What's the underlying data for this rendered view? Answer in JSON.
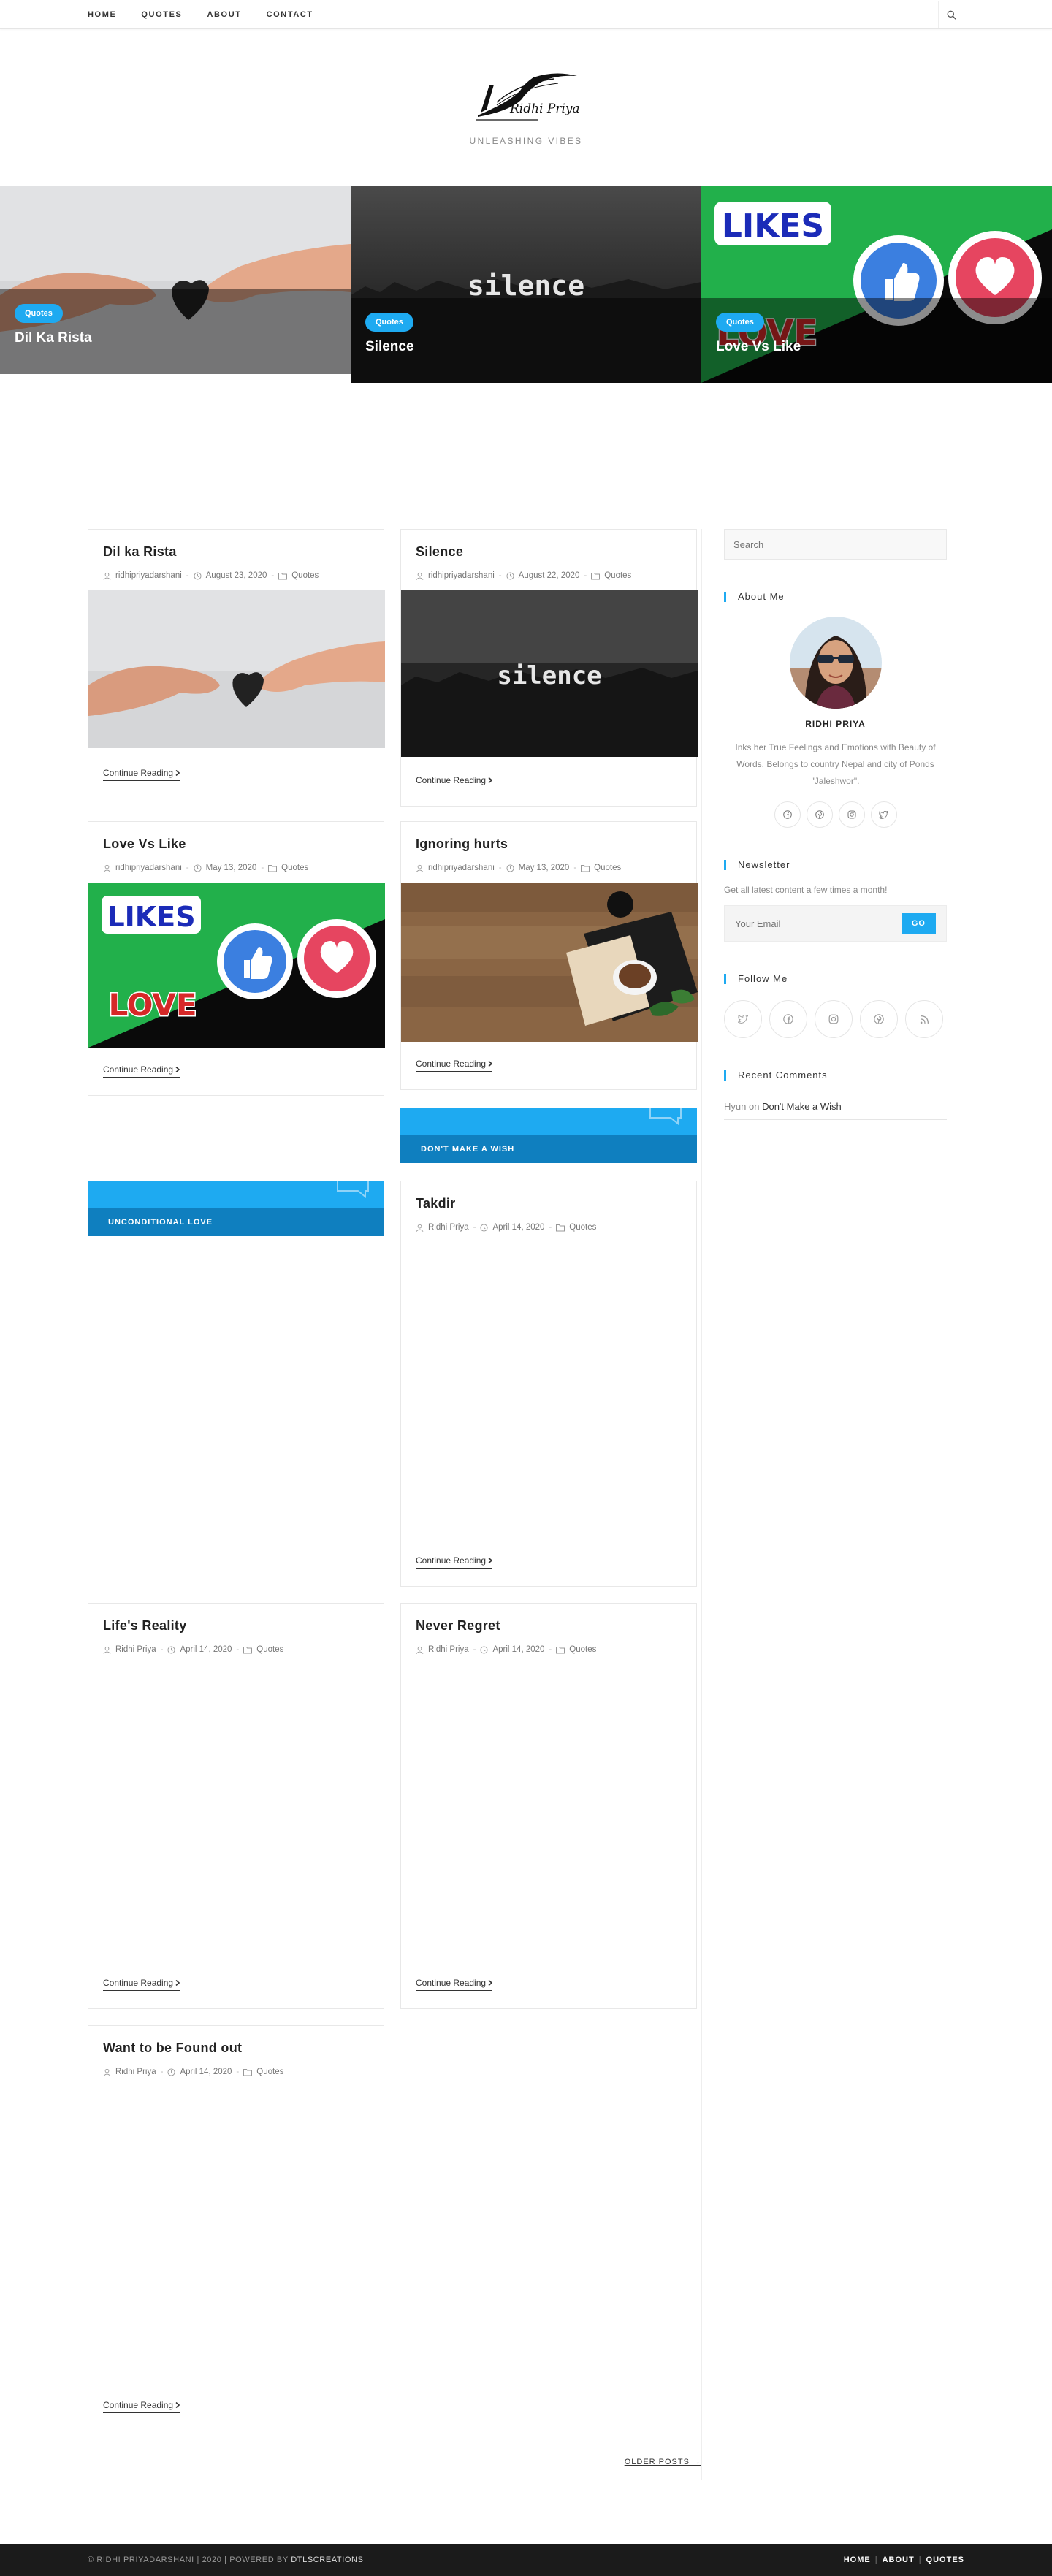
{
  "nav": {
    "items": [
      {
        "label": "HOME"
      },
      {
        "label": "QUOTES"
      },
      {
        "label": "ABOUT"
      },
      {
        "label": "CONTACT"
      }
    ]
  },
  "header": {
    "logo_text": "Ridhi Priya",
    "tagline": "UNLEASHING VIBES"
  },
  "slider": [
    {
      "badge": "Quotes",
      "title": "Dil Ka Rista"
    },
    {
      "badge": "Quotes",
      "title": "Silence",
      "image_text": "silence"
    },
    {
      "badge": "Quotes",
      "title": "Love Vs Like",
      "image_text_top": "LIKES",
      "image_text_bottom": "LOVE"
    }
  ],
  "posts": [
    {
      "title": "Dil ka Rista",
      "author": "ridhipriyadarshani",
      "date": "August 23, 2020",
      "category": "Quotes",
      "more": "Continue Reading"
    },
    {
      "title": "Silence",
      "author": "ridhipriyadarshani",
      "date": "August 22, 2020",
      "category": "Quotes",
      "more": "Continue Reading",
      "image_text": "silence"
    },
    {
      "title": "Love Vs Like",
      "author": "ridhipriyadarshani",
      "date": "May 13, 2020",
      "category": "Quotes",
      "more": "Continue Reading",
      "image_text_top": "LIKES",
      "image_text_bottom": "LOVE"
    },
    {
      "title": "Ignoring hurts",
      "author": "ridhipriyadarshani",
      "date": "May 13, 2020",
      "category": "Quotes",
      "more": "Continue Reading"
    },
    {
      "title": "Takdir",
      "author": "Ridhi Priya",
      "date": "April 14, 2020",
      "category": "Quotes",
      "more": "Continue Reading"
    },
    {
      "title": "Life's Reality",
      "author": "Ridhi Priya",
      "date": "April 14, 2020",
      "category": "Quotes",
      "more": "Continue Reading"
    },
    {
      "title": "Never Regret",
      "author": "Ridhi Priya",
      "date": "April 14, 2020",
      "category": "Quotes",
      "more": "Continue Reading"
    },
    {
      "title": "Want to be Found out",
      "author": "Ridhi Priya",
      "date": "April 14, 2020",
      "category": "Quotes",
      "more": "Continue Reading"
    }
  ],
  "banners": {
    "wish": "DON'T MAKE A WISH",
    "love": "UNCONDITIONAL LOVE"
  },
  "pagination": {
    "older": "OLDER POSTS →"
  },
  "sidebar": {
    "search_placeholder": "Search",
    "about": {
      "title": "About Me",
      "name": "RIDHI PRIYA",
      "bio": "Inks her True Feelings and Emotions with Beauty of Words. Belongs to country Nepal and city of Ponds \"Jaleshwor\"."
    },
    "newsletter": {
      "title": "Newsletter",
      "text": "Get all latest content a few times a month!",
      "placeholder": "Your Email",
      "button": "GO"
    },
    "follow": {
      "title": "Follow Me"
    },
    "recent": {
      "title": "Recent Comments",
      "author": "Hyun",
      "on": "on",
      "link": "Don't Make a Wish"
    }
  },
  "footer": {
    "copyright": "© RIDHI PRIYADARSHANI | 2020 | POWERED BY",
    "powered": "DTLSCREATIONS",
    "menu": [
      {
        "label": "HOME"
      },
      {
        "label": "ABOUT"
      },
      {
        "label": "QUOTES"
      }
    ]
  },
  "colors": {
    "accent": "#1eaaf1",
    "accent_dark": "#0f7fbf",
    "footer_bg": "#1b1b1b",
    "green": "#22b04b"
  },
  "icons": [
    "search-icon",
    "user-icon",
    "clock-icon",
    "folder-icon",
    "chevron-right-icon",
    "facebook-icon",
    "pinterest-icon",
    "instagram-icon",
    "twitter-icon",
    "rss-icon",
    "chat-bubble-icon"
  ]
}
